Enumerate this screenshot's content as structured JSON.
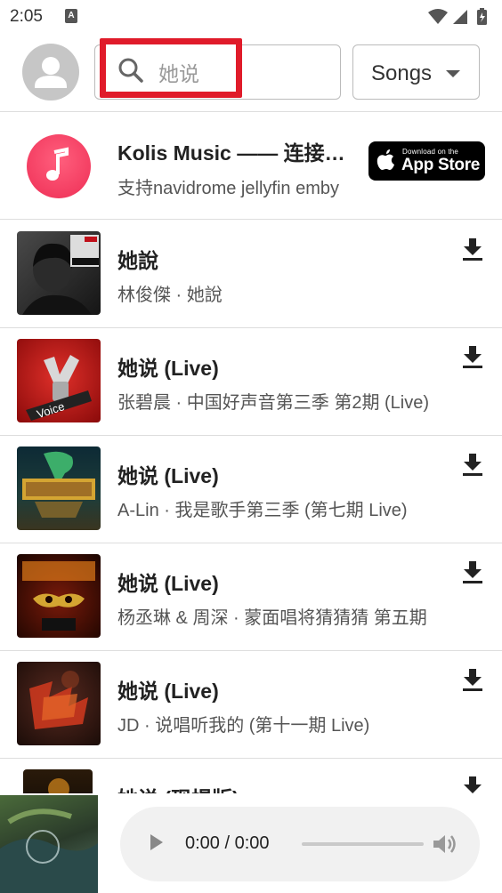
{
  "status_bar": {
    "time": "2:05",
    "sim_label": "A"
  },
  "header": {
    "search_placeholder": "她说",
    "filter_label": "Songs"
  },
  "promo": {
    "title": "Kolis Music —— 连接你的音乐",
    "subtitle": "支持navidrome jellyfin emby",
    "store_small": "Download on the",
    "store_big": "App Store"
  },
  "songs": [
    {
      "title": "她說",
      "subtitle": "林俊傑 · 她說"
    },
    {
      "title": "她说 (Live)",
      "subtitle": "张碧晨 · 中国好声音第三季 第2期 (Live)"
    },
    {
      "title": "她说 (Live)",
      "subtitle": "A-Lin · 我是歌手第三季 (第七期 Live)"
    },
    {
      "title": "她说 (Live)",
      "subtitle": "杨丞琳 & 周深 · 蒙面唱将猜猜猜 第五期"
    },
    {
      "title": "她说 (Live)",
      "subtitle": "JD · 说唱听我的 (第十一期 Live)"
    },
    {
      "title": "她说 (现場版)",
      "subtitle": ""
    }
  ],
  "player": {
    "time": "0:00 / 0:00",
    "progress": 0
  },
  "colors": {
    "accent_red": "#e01b2a",
    "app_icon": "#ef3559"
  },
  "icons": [
    "user-avatar-icon",
    "search-icon",
    "chevron-down-icon",
    "music-note-icon",
    "apple-icon",
    "download-icon",
    "play-icon",
    "volume-icon"
  ]
}
